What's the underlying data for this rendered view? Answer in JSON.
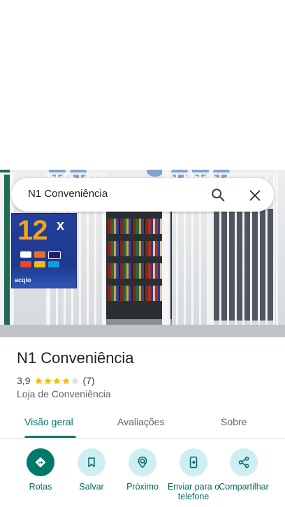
{
  "search": {
    "query": "N1 Conveniência"
  },
  "place": {
    "title": "N1 Conveniência",
    "rating": "3,9",
    "review_count": "(7)",
    "stars_filled": 4,
    "category": "Loja de Conveniência"
  },
  "photo": {
    "poster_main": "12",
    "poster_suffix": "x",
    "poster_brand": "acqio"
  },
  "tabs": [
    {
      "label": "Visão geral",
      "active": true
    },
    {
      "label": "Avaliações",
      "active": false
    },
    {
      "label": "Sobre",
      "active": false
    }
  ],
  "actions": [
    {
      "label": "Rotas",
      "icon": "directions-icon"
    },
    {
      "label": "Salvar",
      "icon": "bookmark-icon"
    },
    {
      "label": "Próximo",
      "icon": "nearby-icon"
    },
    {
      "label": "Enviar para o telefone",
      "icon": "send-to-phone-icon"
    },
    {
      "label": "Compartilhar",
      "icon": "share-icon"
    }
  ],
  "colors": {
    "accent": "#00796b",
    "action_bg": "#cdeff4",
    "star": "#fbbc04",
    "star_empty": "#dadce0"
  }
}
